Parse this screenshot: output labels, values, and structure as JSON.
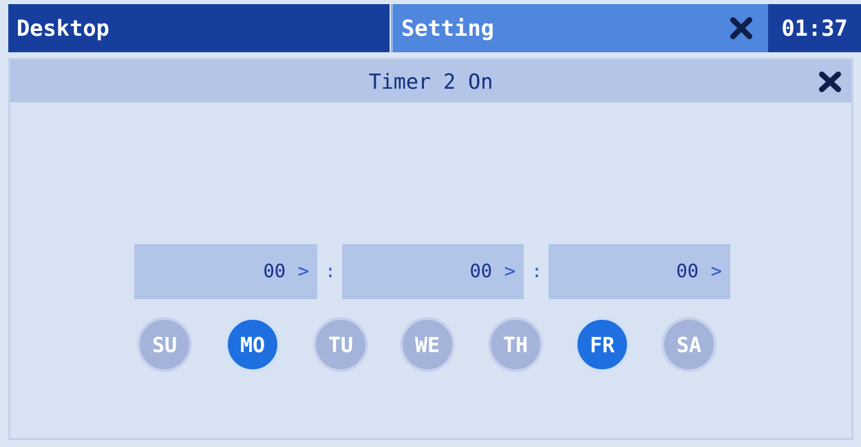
{
  "topbar": {
    "desktop_label": "Desktop",
    "setting_label": "Setting",
    "clock": "01:37"
  },
  "dialog": {
    "title": "Timer 2 On",
    "close_icon": "close-icon"
  },
  "time": {
    "hours": "00",
    "minutes": "00",
    "seconds": "00",
    "separator": ":",
    "arrow_glyph": ">"
  },
  "days": [
    {
      "label": "SU",
      "selected": false
    },
    {
      "label": "MO",
      "selected": true
    },
    {
      "label": "TU",
      "selected": false
    },
    {
      "label": "WE",
      "selected": false
    },
    {
      "label": "TH",
      "selected": false
    },
    {
      "label": "FR",
      "selected": true
    },
    {
      "label": "SA",
      "selected": false
    }
  ],
  "colors": {
    "header_dark": "#173e9c",
    "header_active": "#4f86de",
    "day_selected": "#1e6fe0",
    "day_unselected": "#a3b3d9",
    "field_bg": "#b3c4e9"
  }
}
